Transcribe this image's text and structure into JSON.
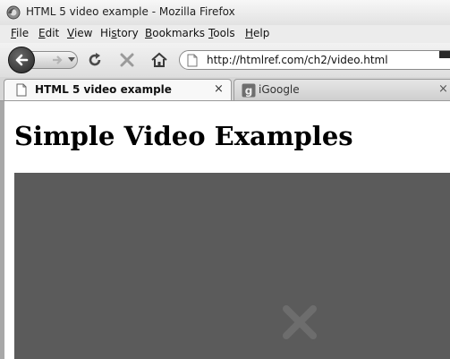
{
  "window": {
    "title": "HTML 5 video example - Mozilla Firefox",
    "icon": "firefox-icon"
  },
  "menu": {
    "items": [
      {
        "label": "File",
        "accel": "F",
        "rest": "ile"
      },
      {
        "label": "Edit",
        "accel": "E",
        "rest": "dit"
      },
      {
        "label": "View",
        "accel": "V",
        "rest": "iew"
      },
      {
        "label": "History",
        "pre": "Hi",
        "accel": "s",
        "rest": "tory"
      },
      {
        "label": "Bookmarks",
        "accel": "B",
        "rest": "ookmarks"
      },
      {
        "label": "Tools",
        "accel": "T",
        "rest": "ools"
      },
      {
        "label": "Help",
        "accel": "H",
        "rest": "elp"
      }
    ]
  },
  "navbar": {
    "url": "http://htmlref.com/ch2/video.html",
    "icons": [
      "back-icon",
      "forward-icon",
      "reload-icon",
      "stop-icon",
      "home-icon",
      "page-icon"
    ]
  },
  "tabs": [
    {
      "label": "HTML 5 video example",
      "close": "×",
      "icon": "document-icon",
      "active": true
    },
    {
      "label": "iGoogle",
      "close": "×",
      "icon": "google-icon",
      "active": false
    }
  ],
  "page": {
    "heading": "Simple Video Examples",
    "video_overlay_icon": "video-error-icon"
  },
  "colors": {
    "video_bg": "#5b5b5b",
    "chrome_bg": "#eaeaea"
  }
}
